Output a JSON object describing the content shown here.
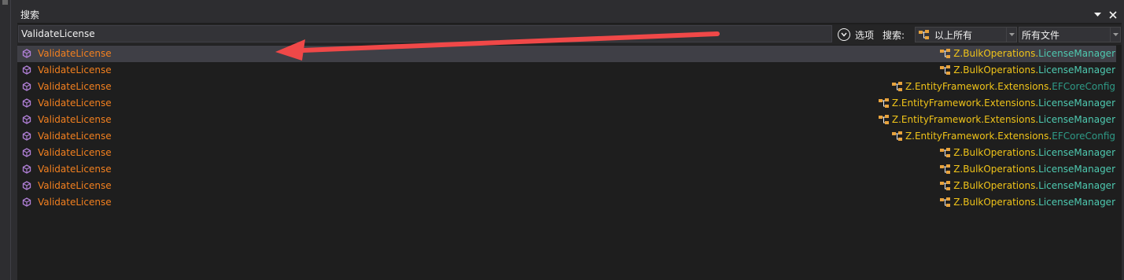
{
  "panel": {
    "title": "搜索"
  },
  "search": {
    "query": "ValidateLicense",
    "options_label": "选项",
    "scope_label": "搜索:",
    "scope_value": "以上所有",
    "files_value": "所有文件"
  },
  "results": [
    {
      "name": "ValidateLicense",
      "namespace": "Z.BulkOperations.",
      "type": "LicenseManager",
      "selected": true
    },
    {
      "name": "ValidateLicense",
      "namespace": "Z.BulkOperations.",
      "type": "LicenseManager"
    },
    {
      "name": "ValidateLicense",
      "namespace": "Z.EntityFramework.Extensions.",
      "type": "EFCoreConfig"
    },
    {
      "name": "ValidateLicense",
      "namespace": "Z.EntityFramework.Extensions.",
      "type": "LicenseManager"
    },
    {
      "name": "ValidateLicense",
      "namespace": "Z.EntityFramework.Extensions.",
      "type": "LicenseManager"
    },
    {
      "name": "ValidateLicense",
      "namespace": "Z.EntityFramework.Extensions.",
      "type": "EFCoreConfig"
    },
    {
      "name": "ValidateLicense",
      "namespace": "Z.BulkOperations.",
      "type": "LicenseManager"
    },
    {
      "name": "ValidateLicense",
      "namespace": "Z.BulkOperations.",
      "type": "LicenseManager"
    },
    {
      "name": "ValidateLicense",
      "namespace": "Z.BulkOperations.",
      "type": "LicenseManager"
    },
    {
      "name": "ValidateLicense",
      "namespace": "Z.BulkOperations.",
      "type": "LicenseManager"
    }
  ],
  "colors": {
    "member_name": "#f3801f",
    "namespace": "#f0c419",
    "type_name": "#4ec9b0",
    "member_icon": "#b180d7",
    "annotation_arrow": "#f04848"
  },
  "icons": {
    "row_member": "method-cube-icon",
    "row_location": "class-icon",
    "scope": "class-icon",
    "options": "chevron-down-circle-icon"
  }
}
